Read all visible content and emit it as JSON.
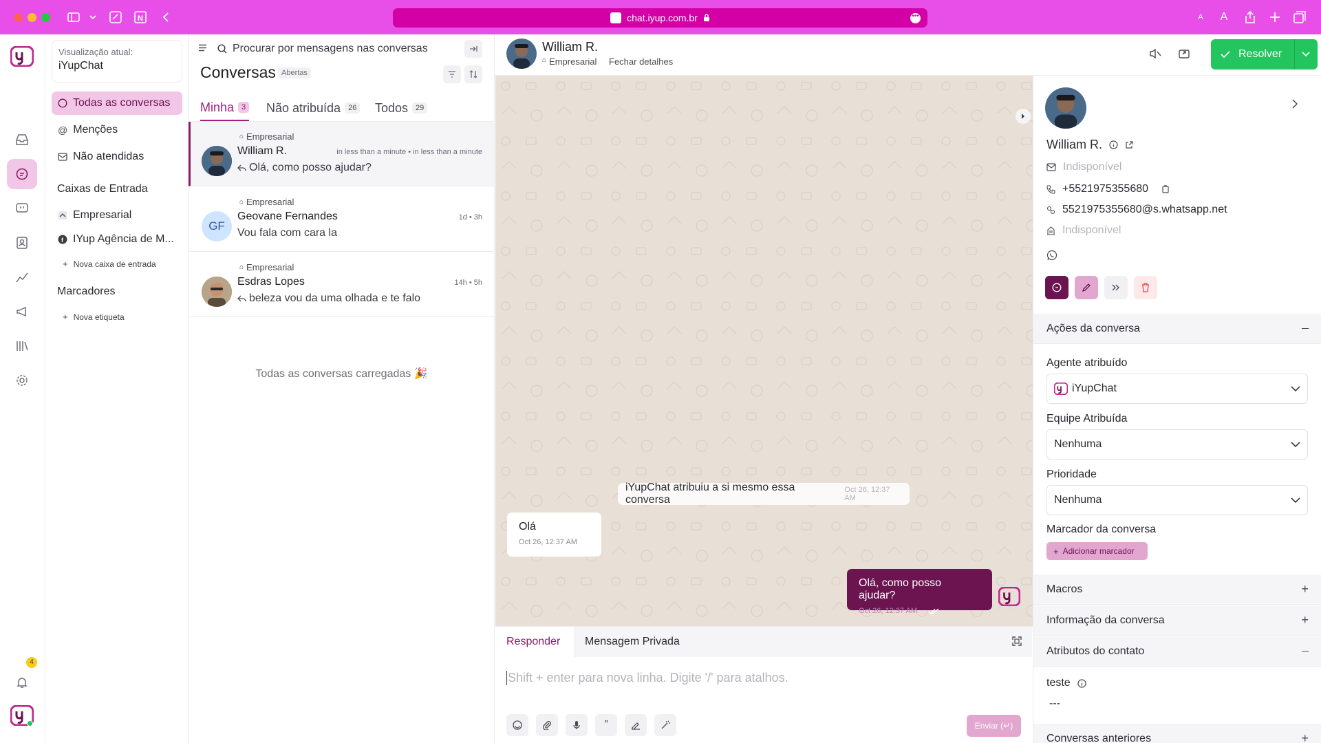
{
  "browser": {
    "url": "chat.iyup.com.br",
    "text_size_small": "A",
    "text_size_large": "A"
  },
  "rail": {
    "notifications_count": "4"
  },
  "sidebar": {
    "current_view_label": "Visualização atual:",
    "current_view_value": "iYupChat",
    "items": [
      {
        "label": "Todas as conversas"
      },
      {
        "label": "Menções"
      },
      {
        "label": "Não atendidas"
      }
    ],
    "inboxes_title": "Caixas de Entrada",
    "inboxes": [
      {
        "label": "Empresarial"
      },
      {
        "label": "IYup Agência de M..."
      }
    ],
    "new_inbox": "Nova caixa de entrada",
    "labels_title": "Marcadores",
    "new_label": "Nova etiqueta"
  },
  "conversations": {
    "search_placeholder": "Procurar por mensagens nas conversas",
    "title": "Conversas",
    "status": "Abertas",
    "tabs": [
      {
        "label": "Minha",
        "count": "3"
      },
      {
        "label": "Não atribuída",
        "count": "26"
      },
      {
        "label": "Todos",
        "count": "29"
      }
    ],
    "items": [
      {
        "inbox": "Empresarial",
        "name": "William R.",
        "message": "Olá, como posso ajudar?",
        "time": "in less than a minute • in less than a minute"
      },
      {
        "inbox": "Empresarial",
        "name": "Geovane Fernandes",
        "initials": "GF",
        "message": "Vou fala com cara la",
        "time": "1d • 3h"
      },
      {
        "inbox": "Empresarial",
        "name": "Esdras Lopes",
        "message": "beleza vou da uma olhada e te falo",
        "time": "14h • 5h"
      }
    ],
    "all_loaded": "Todas as conversas carregadas 🎉"
  },
  "chat": {
    "contact_name": "William R.",
    "inbox": "Empresarial",
    "close_details": "Fechar detalhes",
    "resolve_label": "Resolver",
    "system_message": "iYupChat atribuiu a si mesmo essa conversa",
    "system_time": "Oct 26, 12:37 AM",
    "incoming": {
      "text": "Olá",
      "time": "Oct 26, 12:37 AM"
    },
    "outgoing": {
      "text": "Olá, como posso ajudar?",
      "time": "Oct 26, 12:37 AM"
    },
    "reply_tab": "Responder",
    "private_tab": "Mensagem Privada",
    "composer_placeholder": "Shift + enter para nova linha. Digite '/' para atalhos.",
    "send_label": "Enviar (↵)"
  },
  "contact": {
    "name": "William R.",
    "email": "Indisponível",
    "phone": "+5521975355680",
    "identifier": "5521975355680@s.whatsapp.net",
    "company": "Indisponível"
  },
  "actions": {
    "title": "Ações da conversa",
    "agent_label": "Agente atribuído",
    "agent_value": "iYupChat",
    "team_label": "Equipe Atribuída",
    "team_value": "Nenhuma",
    "priority_label": "Prioridade",
    "priority_value": "Nenhuma",
    "tag_label": "Marcador da conversa",
    "add_tag": "Adicionar marcador"
  },
  "sections": {
    "macros": "Macros",
    "conversation_info": "Informação da conversa",
    "contact_attributes": "Atributos do contato",
    "attribute_name": "teste",
    "attribute_value": "---",
    "previous": "Conversas anteriores"
  },
  "colors": {
    "browser_chrome": "#e84fe8",
    "accent": "#6b1450",
    "resolve_green": "#22c55e"
  }
}
